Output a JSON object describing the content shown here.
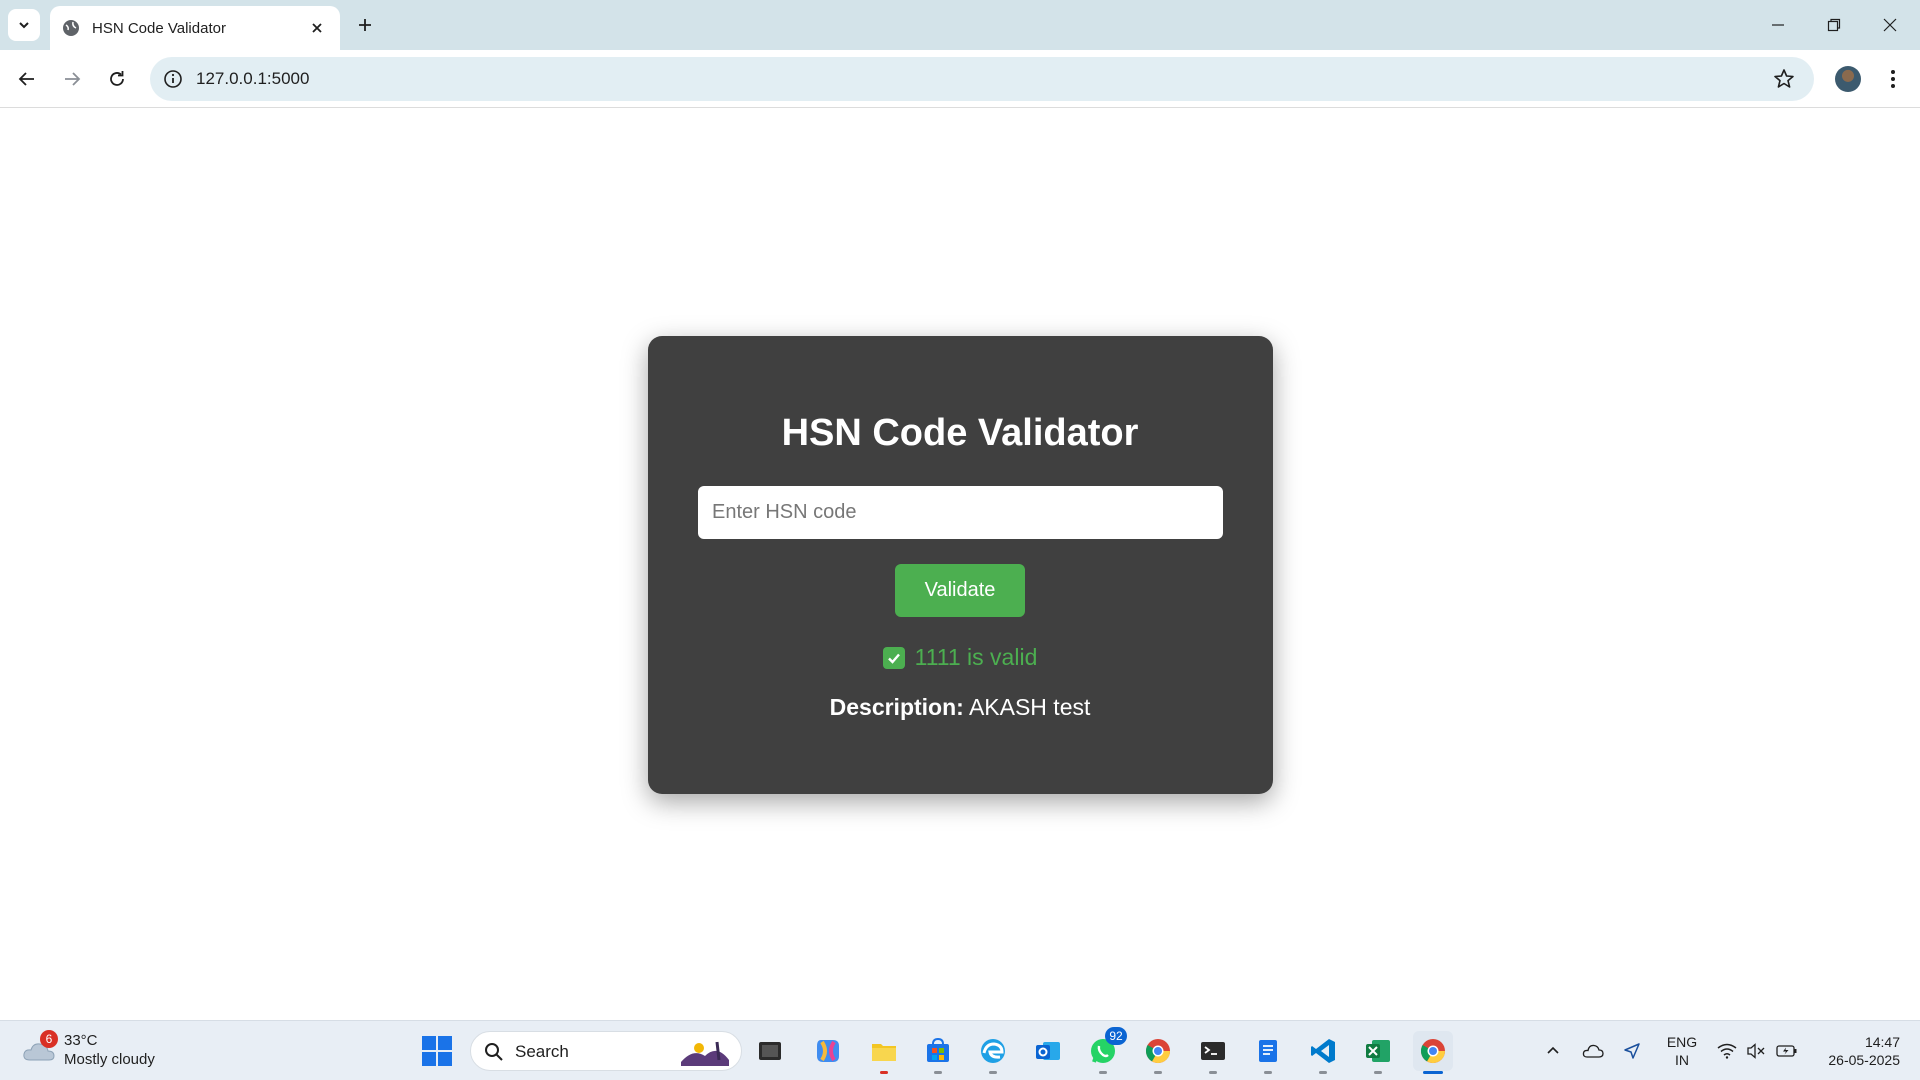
{
  "browser": {
    "tab_title": "HSN Code Validator",
    "url": "127.0.0.1:5000"
  },
  "page": {
    "title": "HSN Code Validator",
    "input_placeholder": "Enter HSN code",
    "input_value": "",
    "validate_label": "Validate",
    "result_text": "1111 is valid",
    "description_label": "Description:",
    "description_value": "AKASH test"
  },
  "taskbar": {
    "weather_badge": "6",
    "weather_temp": "33°C",
    "weather_condition": "Mostly cloudy",
    "search_label": "Search",
    "whatsapp_badge": "92",
    "lang_line1": "ENG",
    "lang_line2": "IN",
    "time": "14:47",
    "date": "26-05-2025",
    "apps": [
      "task-view",
      "copilot",
      "file-explorer",
      "microsoft-store",
      "edge",
      "outlook",
      "whatsapp",
      "chrome-profile",
      "terminal",
      "notepad",
      "vscode",
      "excel",
      "chrome"
    ]
  },
  "colors": {
    "card_bg": "#404040",
    "accent_green": "#4caf50",
    "tabbar_bg": "#d3e3e9",
    "omnibox_bg": "#e2eef3"
  }
}
